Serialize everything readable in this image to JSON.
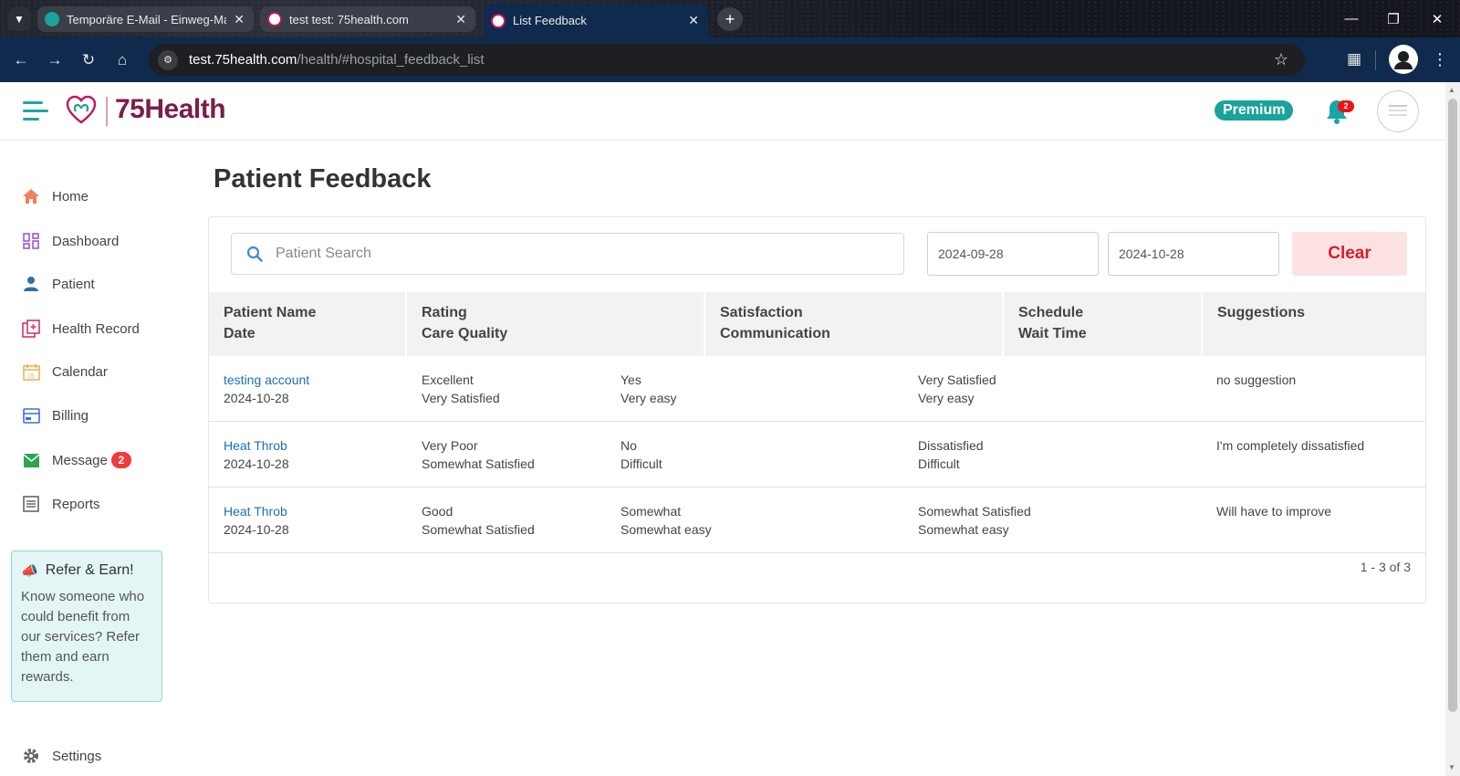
{
  "browser": {
    "tabs": [
      {
        "title": "Temporäre E-Mail - Einweg-Mail",
        "active": false
      },
      {
        "title": "test test: 75health.com",
        "active": false
      },
      {
        "title": "List Feedback",
        "active": true
      }
    ],
    "url_host": "test.75health.com",
    "url_path": "/health/#hospital_feedback_list"
  },
  "header": {
    "logo_text": "75Health",
    "premium_label": "Premium",
    "notification_count": "2",
    "brand_color": "#7b1d49",
    "accent_color": "#19a39a"
  },
  "sidebar": {
    "items": [
      {
        "label": "Home",
        "icon": "home-icon"
      },
      {
        "label": "Dashboard",
        "icon": "dashboard-icon"
      },
      {
        "label": "Patient",
        "icon": "patient-icon"
      },
      {
        "label": "Health Record",
        "icon": "health-record-icon"
      },
      {
        "label": "Calendar",
        "icon": "calendar-icon"
      },
      {
        "label": "Billing",
        "icon": "billing-icon"
      },
      {
        "label": "Message",
        "icon": "message-icon",
        "badge": "2"
      },
      {
        "label": "Reports",
        "icon": "reports-icon"
      }
    ],
    "refer": {
      "title": "Refer & Earn!",
      "body": "Know someone who could benefit from our services? Refer them and earn rewards."
    },
    "settings_label": "Settings"
  },
  "main": {
    "title": "Patient Feedback",
    "search_placeholder": "Patient Search",
    "date_from": "2024-09-28",
    "date_to": "2024-10-28",
    "clear_label": "Clear",
    "columns": [
      {
        "line1": "Patient Name",
        "line2": "Date"
      },
      {
        "line1": "Rating",
        "line2": "Care Quality"
      },
      {
        "line1": "Satisfaction",
        "line2": "Communication"
      },
      {
        "line1": "Schedule",
        "line2": "Wait Time"
      },
      {
        "line1": "Suggestions",
        "line2": ""
      }
    ],
    "rows": [
      {
        "name": "testing account",
        "date": "2024-10-28",
        "rating": "Excellent",
        "care_quality": "Very Satisfied",
        "satisfaction": "Yes",
        "communication": "Very easy",
        "schedule": "Very Satisfied",
        "wait_time": "Very easy",
        "suggestion": "no suggestion"
      },
      {
        "name": "Heat Throb",
        "date": "2024-10-28",
        "rating": "Very Poor",
        "care_quality": "Somewhat Satisfied",
        "satisfaction": "No",
        "communication": "Difficult",
        "schedule": "Dissatisfied",
        "wait_time": "Difficult",
        "suggestion": "I'm completely dissatisfied"
      },
      {
        "name": "Heat Throb",
        "date": "2024-10-28",
        "rating": "Good",
        "care_quality": "Somewhat Satisfied",
        "satisfaction": "Somewhat",
        "communication": "Somewhat easy",
        "schedule": "Somewhat Satisfied",
        "wait_time": "Somewhat easy",
        "suggestion": "Will have to improve"
      }
    ],
    "pagination": "1 - 3 of 3"
  }
}
